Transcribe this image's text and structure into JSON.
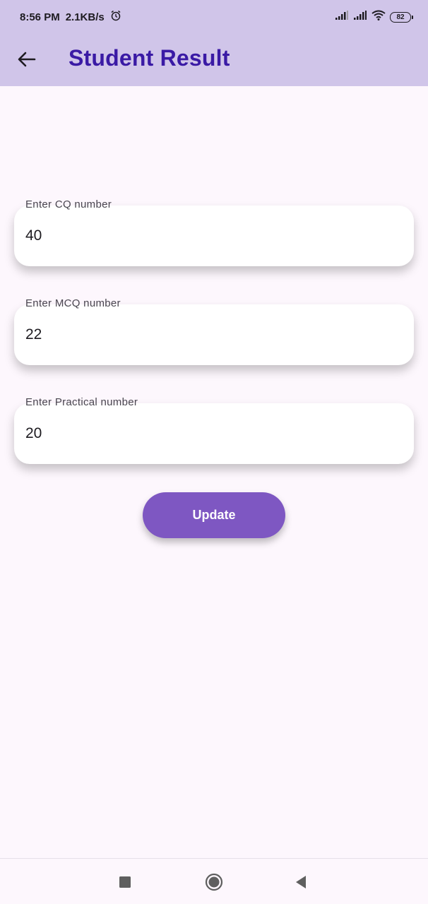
{
  "status_bar": {
    "time": "8:56 PM",
    "network_speed": "2.1KB/s",
    "battery_level": "82",
    "icons": [
      "alarm-icon",
      "signal-icon",
      "signal-icon",
      "wifi-icon",
      "battery-icon"
    ]
  },
  "app_bar": {
    "title": "Student Result",
    "back_icon": "arrow-left-icon"
  },
  "form": {
    "cq": {
      "label": "Enter CQ number",
      "value": "40"
    },
    "mcq": {
      "label": "Enter MCQ number",
      "value": "22"
    },
    "practical": {
      "label": "Enter Practical number",
      "value": "20"
    }
  },
  "actions": {
    "update_label": "Update"
  },
  "navigation": {
    "items": [
      "square-recents-icon",
      "circle-home-icon",
      "triangle-back-icon"
    ]
  },
  "colors": {
    "app_bar_background": "#d0c5e9",
    "title_color": "#3a1aa5",
    "button_background": "#7e57c2",
    "page_background": "#fdf7fd"
  }
}
